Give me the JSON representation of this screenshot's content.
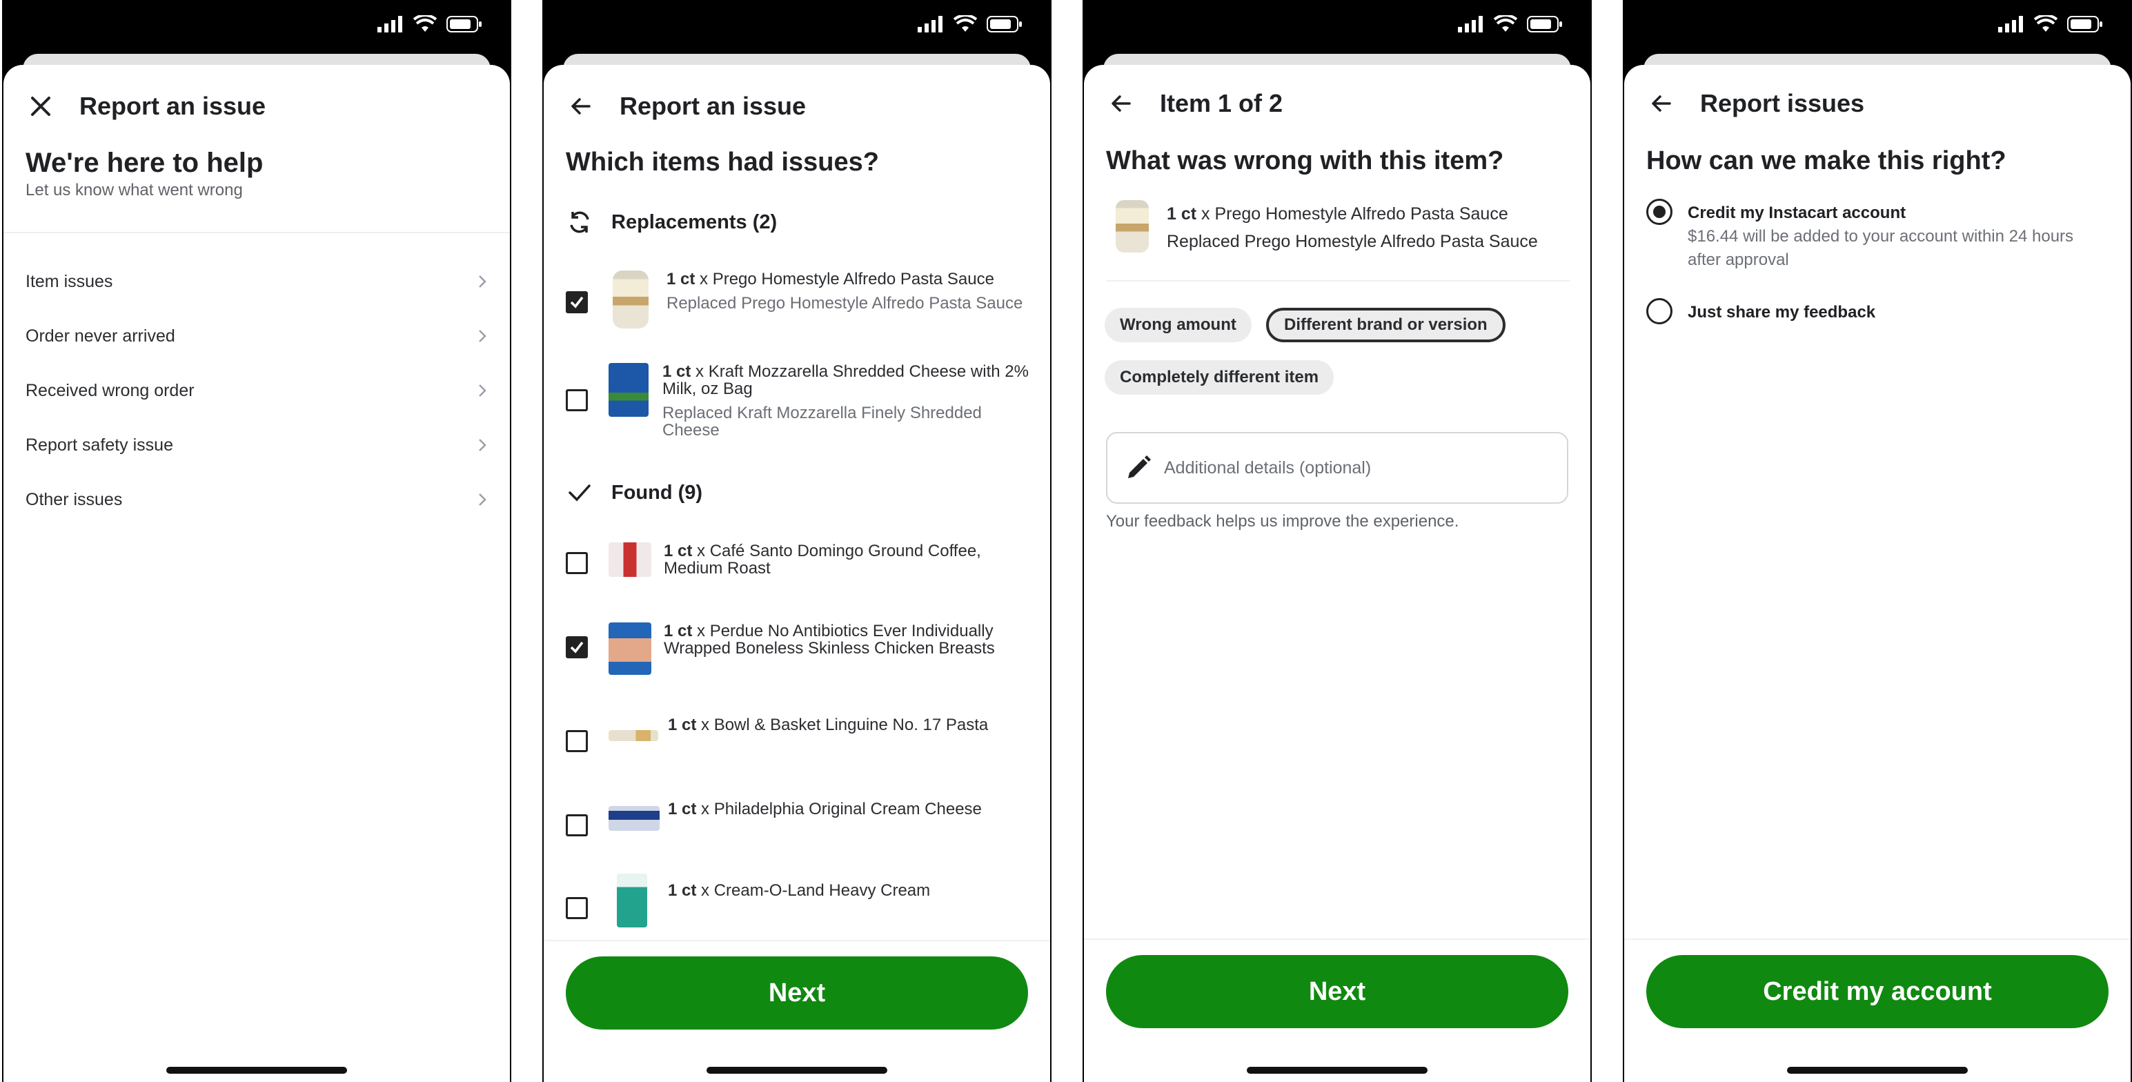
{
  "screens": {
    "s1": {
      "title": "Report an issue",
      "heading": "We're here to help",
      "subheading": "Let us know what went wrong",
      "menu": [
        {
          "label": "Item issues"
        },
        {
          "label": "Order never arrived"
        },
        {
          "label": "Received wrong order"
        },
        {
          "label": "Report safety issue"
        },
        {
          "label": "Other issues"
        }
      ]
    },
    "s2": {
      "title": "Report an issue",
      "heading": "Which items had issues?",
      "replacements_label": "Replacements (2)",
      "found_label": "Found (9)",
      "items": [
        {
          "qty": "1 ct",
          "name": "x Prego Homestyle Alfredo Pasta Sauce",
          "replaced": "Replaced Prego Homestyle Alfredo Pasta Sauce",
          "checked": true
        },
        {
          "qty": "1 ct",
          "name": "x Kraft Mozzarella Shredded Cheese with 2% Milk, oz Bag",
          "replaced": "Replaced Kraft Mozzarella Finely Shredded Cheese",
          "checked": false
        },
        {
          "qty": "1 ct",
          "name": "x Café Santo Domingo Ground Coffee, Medium Roast",
          "checked": false
        },
        {
          "qty": "1 ct",
          "name": "x Perdue No Antibiotics Ever Individually Wrapped Boneless Skinless Chicken Breasts",
          "checked": true
        },
        {
          "qty": "1 ct",
          "name": "x Bowl & Basket Linguine No. 17 Pasta",
          "checked": false
        },
        {
          "qty": "1 ct",
          "name": "x Philadelphia Original Cream Cheese",
          "checked": false
        },
        {
          "qty": "1 ct",
          "name": "x Cream-O-Land Heavy Cream",
          "checked": false
        }
      ],
      "next_label": "Next"
    },
    "s3": {
      "title": "Item 1 of 2",
      "heading": "What was wrong with this item?",
      "product_qty": "1 ct",
      "product_name": "x Prego Homestyle Alfredo Pasta Sauce",
      "product_replaced": "Replaced Prego Homestyle Alfredo Pasta Sauce",
      "chips": [
        "Wrong amount",
        "Different brand or version",
        "Completely different item"
      ],
      "selected_chip": "Different brand or version",
      "details_placeholder": "Additional details (optional)",
      "helper": "Your feedback helps us improve the experience.",
      "next_label": "Next"
    },
    "s4": {
      "title": "Report issues",
      "heading": "How can we make this right?",
      "options": [
        {
          "title": "Credit my Instacart account",
          "desc": "$16.44 will be added to your account within 24 hours after approval",
          "selected": true
        },
        {
          "title": "Just share my feedback",
          "desc": "",
          "selected": false
        }
      ],
      "cta_label": "Credit my account"
    }
  },
  "icons": [
    "signal-icon",
    "wifi-icon",
    "battery-icon",
    "close-icon",
    "back-arrow-icon",
    "chevron-right-icon",
    "refresh-icon",
    "checkmark-icon",
    "pencil-icon"
  ],
  "colors": {
    "accent": "#108910",
    "text": "#202124",
    "muted": "#6b6f75",
    "chip": "#ececec"
  }
}
